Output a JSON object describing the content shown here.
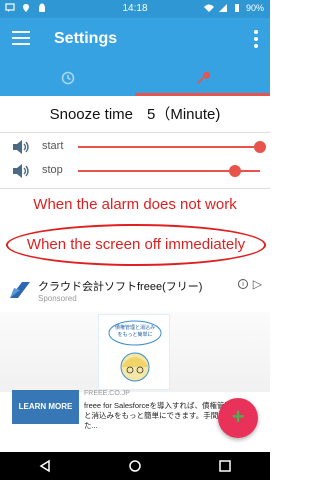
{
  "status_bar": {
    "time": "14:18",
    "battery": "90%"
  },
  "app_bar": {
    "title": "Settings"
  },
  "tabs": [
    {
      "name": "tab-alarm",
      "icon": "clock-icon",
      "active": false
    },
    {
      "name": "tab-settings",
      "icon": "wrench-icon",
      "active": true
    }
  ],
  "snooze": {
    "label": "Snooze time",
    "value": "5（Minute)"
  },
  "sliders": {
    "start": {
      "label": "start",
      "level": 1.0
    },
    "stop": {
      "label": "stop",
      "level": 0.86
    }
  },
  "warnings": {
    "alarm_not_work": "When the alarm does not work",
    "screen_off": "When the screen off immediately"
  },
  "ad": {
    "title": "クラウド会計ソフトfreee(フリー)",
    "sponsored": "Sponsored",
    "cta": "LEARN MORE",
    "domain": "FREEE.CO.JP",
    "description": "freee for Salesforceを導入すれば、債権管理と消込みをもっと簡単にできます。手間だった...",
    "card_text": "債権管理と消込みをもっと簡単に"
  },
  "fab": {
    "symbol": "+"
  },
  "colors": {
    "primary": "#37a2e2",
    "status": "#2f98d4",
    "accent": "#e8544c",
    "warning": "#e02020",
    "fab": "#e8325a"
  }
}
